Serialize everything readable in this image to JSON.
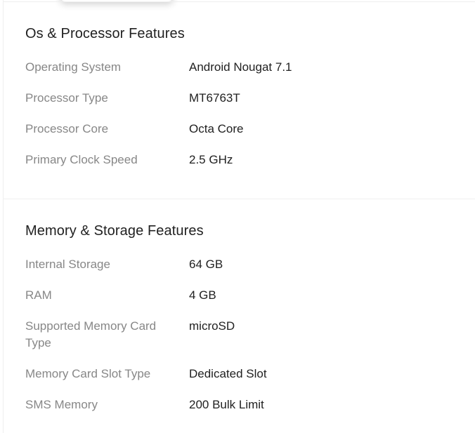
{
  "sections": [
    {
      "title": "Os & Processor Features",
      "rows": [
        {
          "label": "Operating System",
          "value": "Android Nougat 7.1"
        },
        {
          "label": "Processor Type",
          "value": "MT6763T"
        },
        {
          "label": "Processor Core",
          "value": "Octa Core"
        },
        {
          "label": "Primary Clock Speed",
          "value": "2.5 GHz"
        }
      ]
    },
    {
      "title": "Memory & Storage Features",
      "rows": [
        {
          "label": "Internal Storage",
          "value": "64 GB"
        },
        {
          "label": "RAM",
          "value": "4 GB"
        },
        {
          "label": "Supported Memory Card Type",
          "value": "microSD"
        },
        {
          "label": "Memory Card Slot Type",
          "value": "Dedicated Slot"
        },
        {
          "label": "SMS Memory",
          "value": "200 Bulk Limit"
        }
      ]
    }
  ]
}
